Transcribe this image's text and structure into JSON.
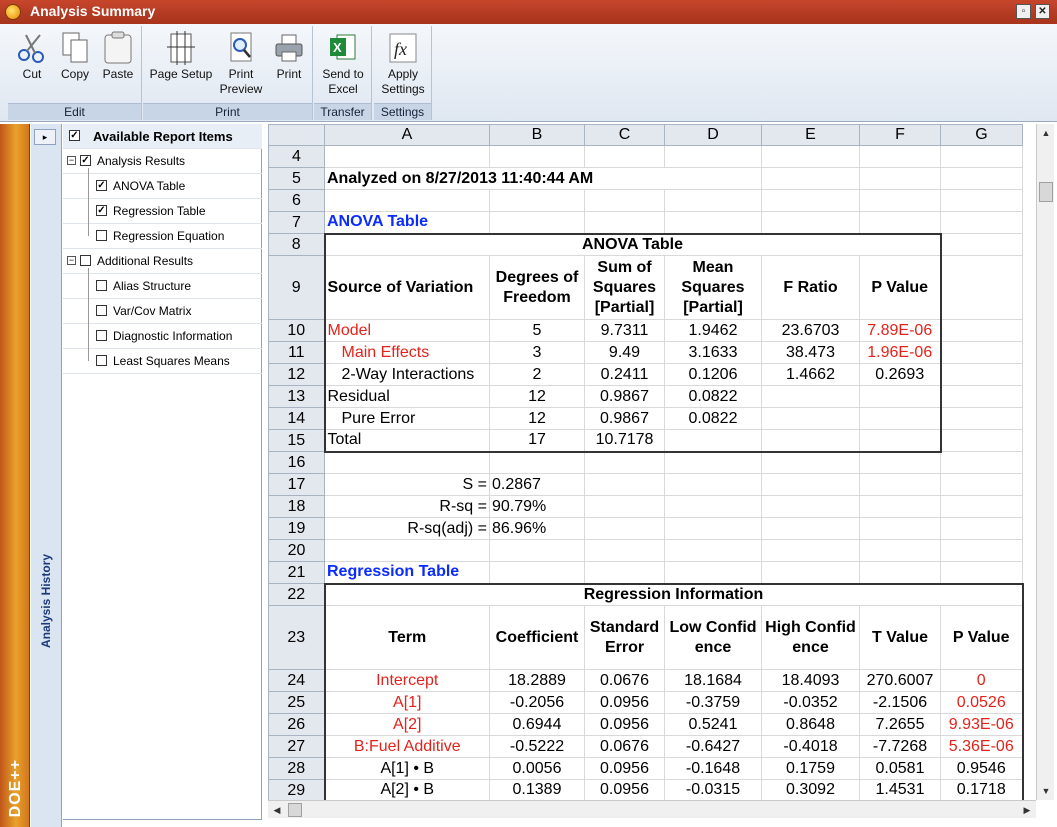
{
  "window": {
    "title": "Analysis Summary",
    "minimize_glyph": "▫",
    "close_glyph": "✕"
  },
  "ribbon": {
    "groups": [
      {
        "label": "Edit",
        "buttons": [
          "Cut",
          "Copy",
          "Paste"
        ]
      },
      {
        "label": "Print",
        "buttons": [
          "Page Setup",
          "Print Preview",
          "Print"
        ]
      },
      {
        "label": "Transfer",
        "buttons": [
          "Send to Excel"
        ]
      },
      {
        "label": "Settings",
        "buttons": [
          "Apply Settings"
        ]
      }
    ],
    "cut": "Cut",
    "copy": "Copy",
    "paste": "Paste",
    "page_setup": "Page Setup",
    "print_preview_1": "Print",
    "print_preview_2": "Preview",
    "print": "Print",
    "send_excel_1": "Send to",
    "send_excel_2": "Excel",
    "apply_1": "Apply",
    "apply_2": "Settings",
    "edit_label": "Edit",
    "print_label": "Print",
    "transfer_label": "Transfer",
    "settings_label": "Settings"
  },
  "sidebar": {
    "brand": "DOE++",
    "history_label": "Analysis History"
  },
  "tree": {
    "header": "Available Report Items",
    "analysis_results": "Analysis Results",
    "anova_table": "ANOVA Table",
    "regression_table": "Regression Table",
    "regression_equation": "Regression Equation",
    "additional_results": "Additional Results",
    "alias_structure": "Alias Structure",
    "var_cov": "Var/Cov Matrix",
    "diagnostic": "Diagnostic Information",
    "lsm": "Least Squares Means"
  },
  "sheet": {
    "cols": [
      "A",
      "B",
      "C",
      "D",
      "E",
      "F",
      "G"
    ],
    "rows": [
      "4",
      "5",
      "6",
      "7",
      "8",
      "9",
      "10",
      "11",
      "12",
      "13",
      "14",
      "15",
      "16",
      "17",
      "18",
      "19",
      "20",
      "21",
      "22",
      "23",
      "24",
      "25",
      "26",
      "27",
      "28",
      "29"
    ],
    "analyzed": "Analyzed on 8/27/2013 11:40:44 AM",
    "anova_heading": "ANOVA Table",
    "anova_title": "ANOVA Table",
    "anova_headers": [
      "Source of Variation",
      "Degrees of Freedom",
      "Sum of Squares [Partial]",
      "Mean Squares [Partial]",
      "F Ratio",
      "P Value"
    ],
    "anova_rows": [
      [
        "Model",
        "5",
        "9.7311",
        "1.9462",
        "23.6703",
        "7.89E-06"
      ],
      [
        "Main Effects",
        "3",
        "9.49",
        "3.1633",
        "38.473",
        "1.96E-06"
      ],
      [
        "2-Way Interactions",
        "2",
        "0.2411",
        "0.1206",
        "1.4662",
        "0.2693"
      ],
      [
        "Residual",
        "12",
        "0.9867",
        "0.0822",
        "",
        ""
      ],
      [
        "Pure Error",
        "12",
        "0.9867",
        "0.0822",
        "",
        ""
      ],
      [
        "Total",
        "17",
        "10.7178",
        "",
        "",
        ""
      ]
    ],
    "s_label": "S =",
    "s_value": "0.2867",
    "rsq_label": "R-sq =",
    "rsq_value": "90.79%",
    "rsqadj_label": "R-sq(adj) =",
    "rsqadj_value": "86.96%",
    "reg_heading": "Regression Table",
    "reg_title": "Regression Information",
    "reg_headers": [
      "Term",
      "Coefficient",
      "Standard Error",
      "Low Confidence",
      "High Confidence",
      "T Value",
      "P Value"
    ],
    "reg_rows": [
      [
        "Intercept",
        "18.2889",
        "0.0676",
        "18.1684",
        "18.4093",
        "270.6007",
        "0"
      ],
      [
        "A[1]",
        "-0.2056",
        "0.0956",
        "-0.3759",
        "-0.0352",
        "-2.1506",
        "0.0526"
      ],
      [
        "A[2]",
        "0.6944",
        "0.0956",
        "0.5241",
        "0.8648",
        "7.2655",
        "9.93E-06"
      ],
      [
        "B:Fuel Additive",
        "-0.5222",
        "0.0676",
        "-0.6427",
        "-0.4018",
        "-7.7268",
        "5.36E-06"
      ],
      [
        "A[1] • B",
        "0.0056",
        "0.0956",
        "-0.1648",
        "0.1759",
        "0.0581",
        "0.9546"
      ],
      [
        "A[2] • B",
        "0.1389",
        "0.0956",
        "-0.0315",
        "0.3092",
        "1.4531",
        "0.1718"
      ]
    ]
  },
  "colors": {
    "title_bar": "#b23a22",
    "significant": "#e3231b",
    "heading": "#0b2cff"
  }
}
